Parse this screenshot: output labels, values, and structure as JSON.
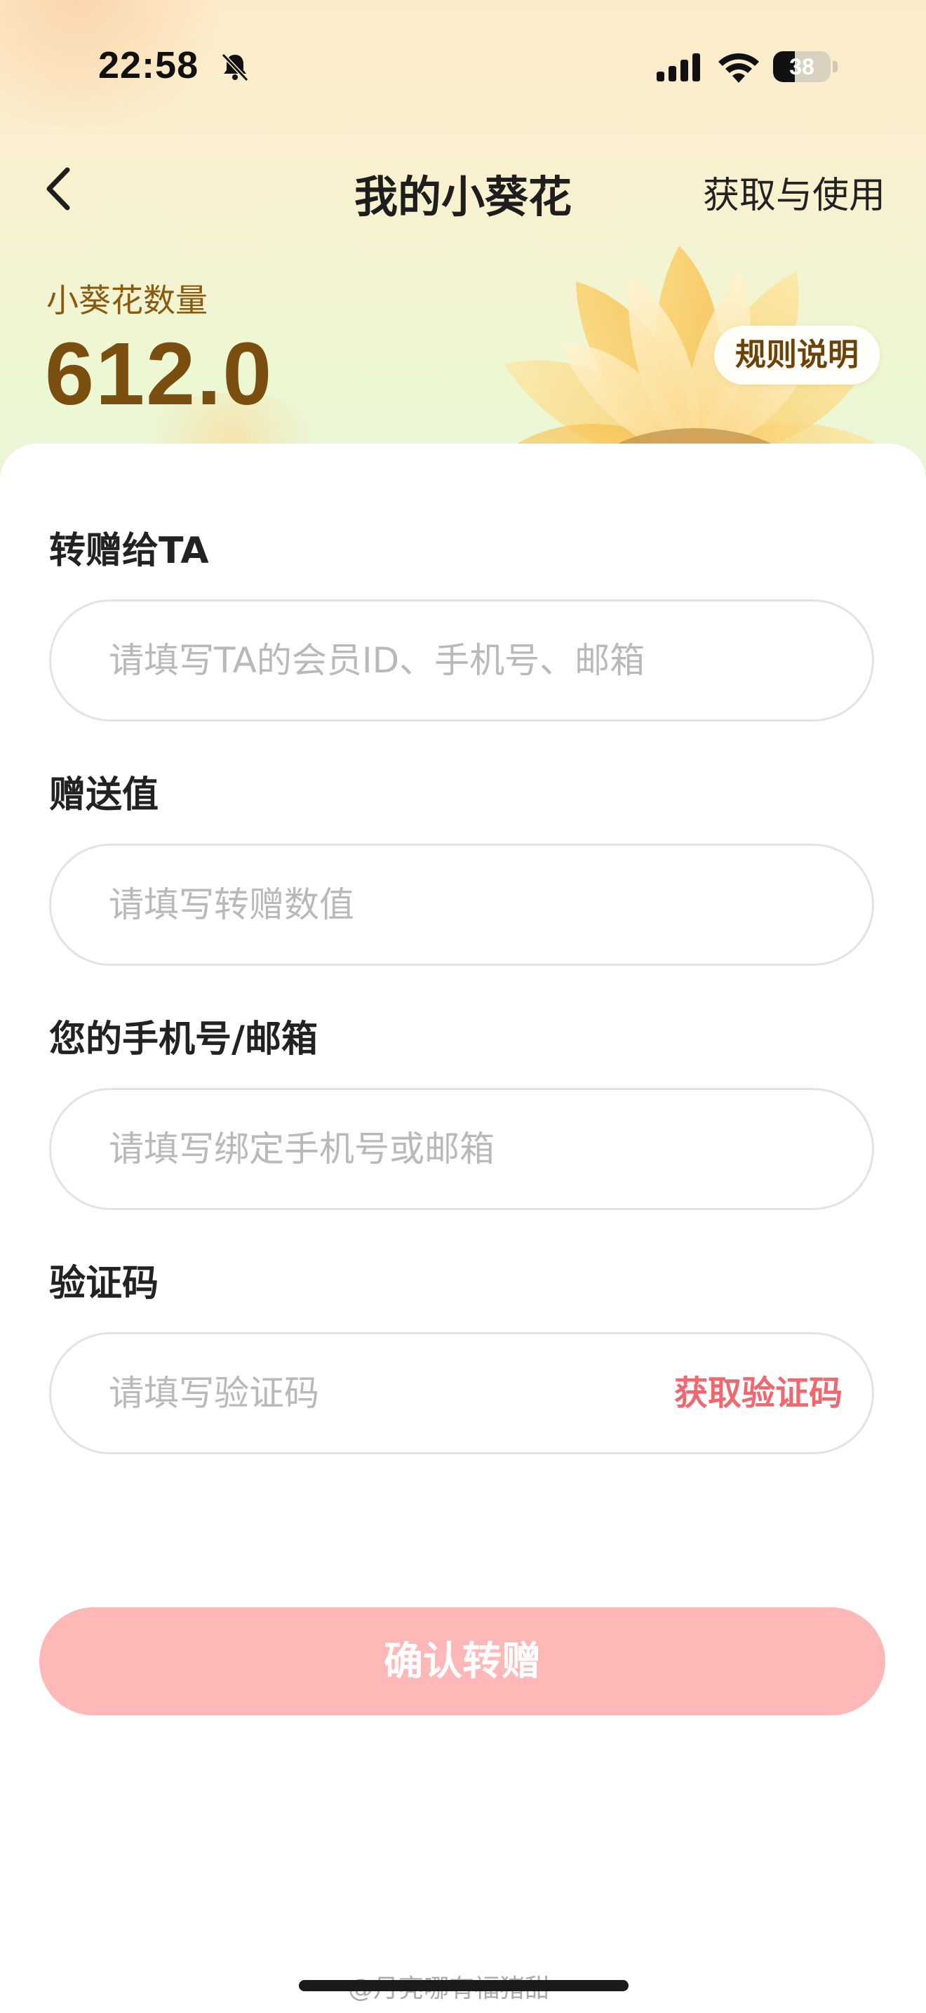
{
  "status_bar": {
    "time": "22:58",
    "battery_level": "38",
    "battery_fraction": 0.38,
    "icons": [
      "bell-slash-icon",
      "cellular-signal-icon",
      "wifi-icon",
      "battery-icon"
    ]
  },
  "nav": {
    "title": "我的小葵花",
    "right_link": "获取与使用",
    "back_icon": "chevron-left-icon"
  },
  "balance": {
    "label": "小葵花数量",
    "value": "612.0",
    "rules_button": "规则说明"
  },
  "form": {
    "recipient": {
      "label": "转赠给TA",
      "placeholder": "请填写TA的会员ID、手机号、邮箱",
      "value": ""
    },
    "amount": {
      "label": "赠送值",
      "placeholder": "请填写转赠数值",
      "value": ""
    },
    "contact": {
      "label": "您的手机号/邮箱",
      "placeholder": "请填写绑定手机号或邮箱",
      "value": ""
    },
    "code": {
      "label": "验证码",
      "placeholder": "请填写验证码",
      "value": "",
      "action": "获取验证码"
    },
    "submit_label": "确认转赠"
  },
  "watermark": "@月亮哪有福猪甜",
  "colors": {
    "accent_red": "#f06770",
    "submit_bg": "#fdb8b7",
    "balance_brown": "#7a4e0e"
  }
}
